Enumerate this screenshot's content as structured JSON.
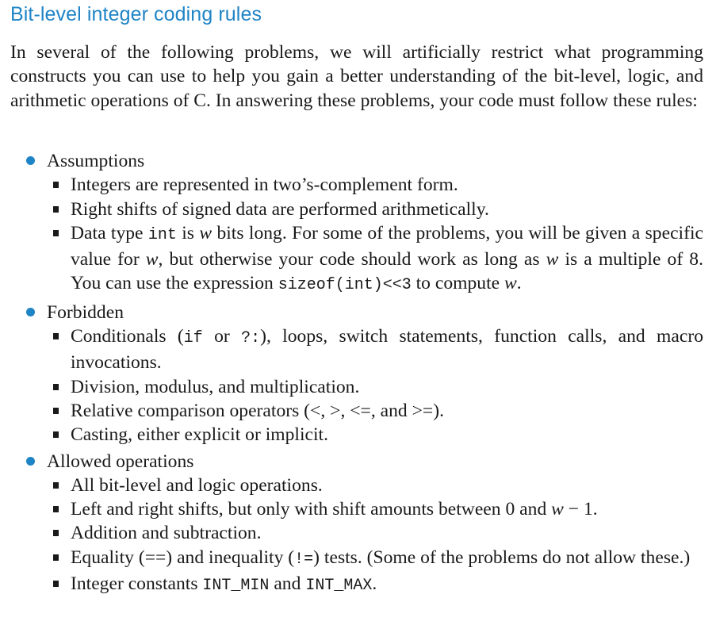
{
  "title": "Bit-level integer coding rules",
  "intro": "In several of the following problems, we will artificially restrict what programming constructs you can use to help you gain a better understanding of the bit-level, logic, and arithmetic operations of C. In answering these problems, your code must follow these rules:",
  "sections": [
    {
      "heading": "Assumptions",
      "items": [
        {
          "parts": [
            {
              "t": "Integers are represented in two’s-complement form."
            }
          ]
        },
        {
          "parts": [
            {
              "t": "Right shifts of signed data are performed arithmetically."
            }
          ]
        },
        {
          "parts": [
            {
              "t": "Data type "
            },
            {
              "t": "int",
              "code": true
            },
            {
              "t": " is "
            },
            {
              "t": "w",
              "math": true
            },
            {
              "t": " bits long. For some of the problems, you will be given a specific value for "
            },
            {
              "t": "w",
              "math": true
            },
            {
              "t": ", but otherwise your code should work as long as "
            },
            {
              "t": "w",
              "math": true
            },
            {
              "t": " is a multiple of 8. You can use the expression "
            },
            {
              "t": "sizeof(int)<<3",
              "code": true
            },
            {
              "t": " to compute "
            },
            {
              "t": "w",
              "math": true
            },
            {
              "t": "."
            }
          ]
        }
      ]
    },
    {
      "heading": "Forbidden",
      "items": [
        {
          "parts": [
            {
              "t": "Conditionals ("
            },
            {
              "t": "if",
              "code": true
            },
            {
              "t": " or "
            },
            {
              "t": "?:",
              "code": true
            },
            {
              "t": "), loops, switch statements, function calls, and macro invocations."
            }
          ]
        },
        {
          "parts": [
            {
              "t": "Division, modulus, and multiplication."
            }
          ]
        },
        {
          "parts": [
            {
              "t": "Relative comparison operators (<, >, <=, and >=)."
            }
          ]
        },
        {
          "parts": [
            {
              "t": "Casting, either explicit or implicit."
            }
          ]
        }
      ]
    },
    {
      "heading": "Allowed operations",
      "items": [
        {
          "parts": [
            {
              "t": "All bit-level and logic operations."
            }
          ]
        },
        {
          "parts": [
            {
              "t": "Left and right shifts, but only with shift amounts between 0 and "
            },
            {
              "t": "w",
              "math": true
            },
            {
              "t": " − 1."
            }
          ]
        },
        {
          "parts": [
            {
              "t": "Addition and subtraction."
            }
          ]
        },
        {
          "parts": [
            {
              "t": "Equality (==) and inequality ("
            },
            {
              "t": "!=",
              "code": true
            },
            {
              "t": ") tests. (Some of the problems do not allow these.)"
            }
          ]
        },
        {
          "parts": [
            {
              "t": "Integer constants "
            },
            {
              "t": "INT_MIN",
              "code": true
            },
            {
              "t": " and "
            },
            {
              "t": "INT_MAX",
              "code": true
            },
            {
              "t": "."
            }
          ]
        }
      ]
    }
  ]
}
